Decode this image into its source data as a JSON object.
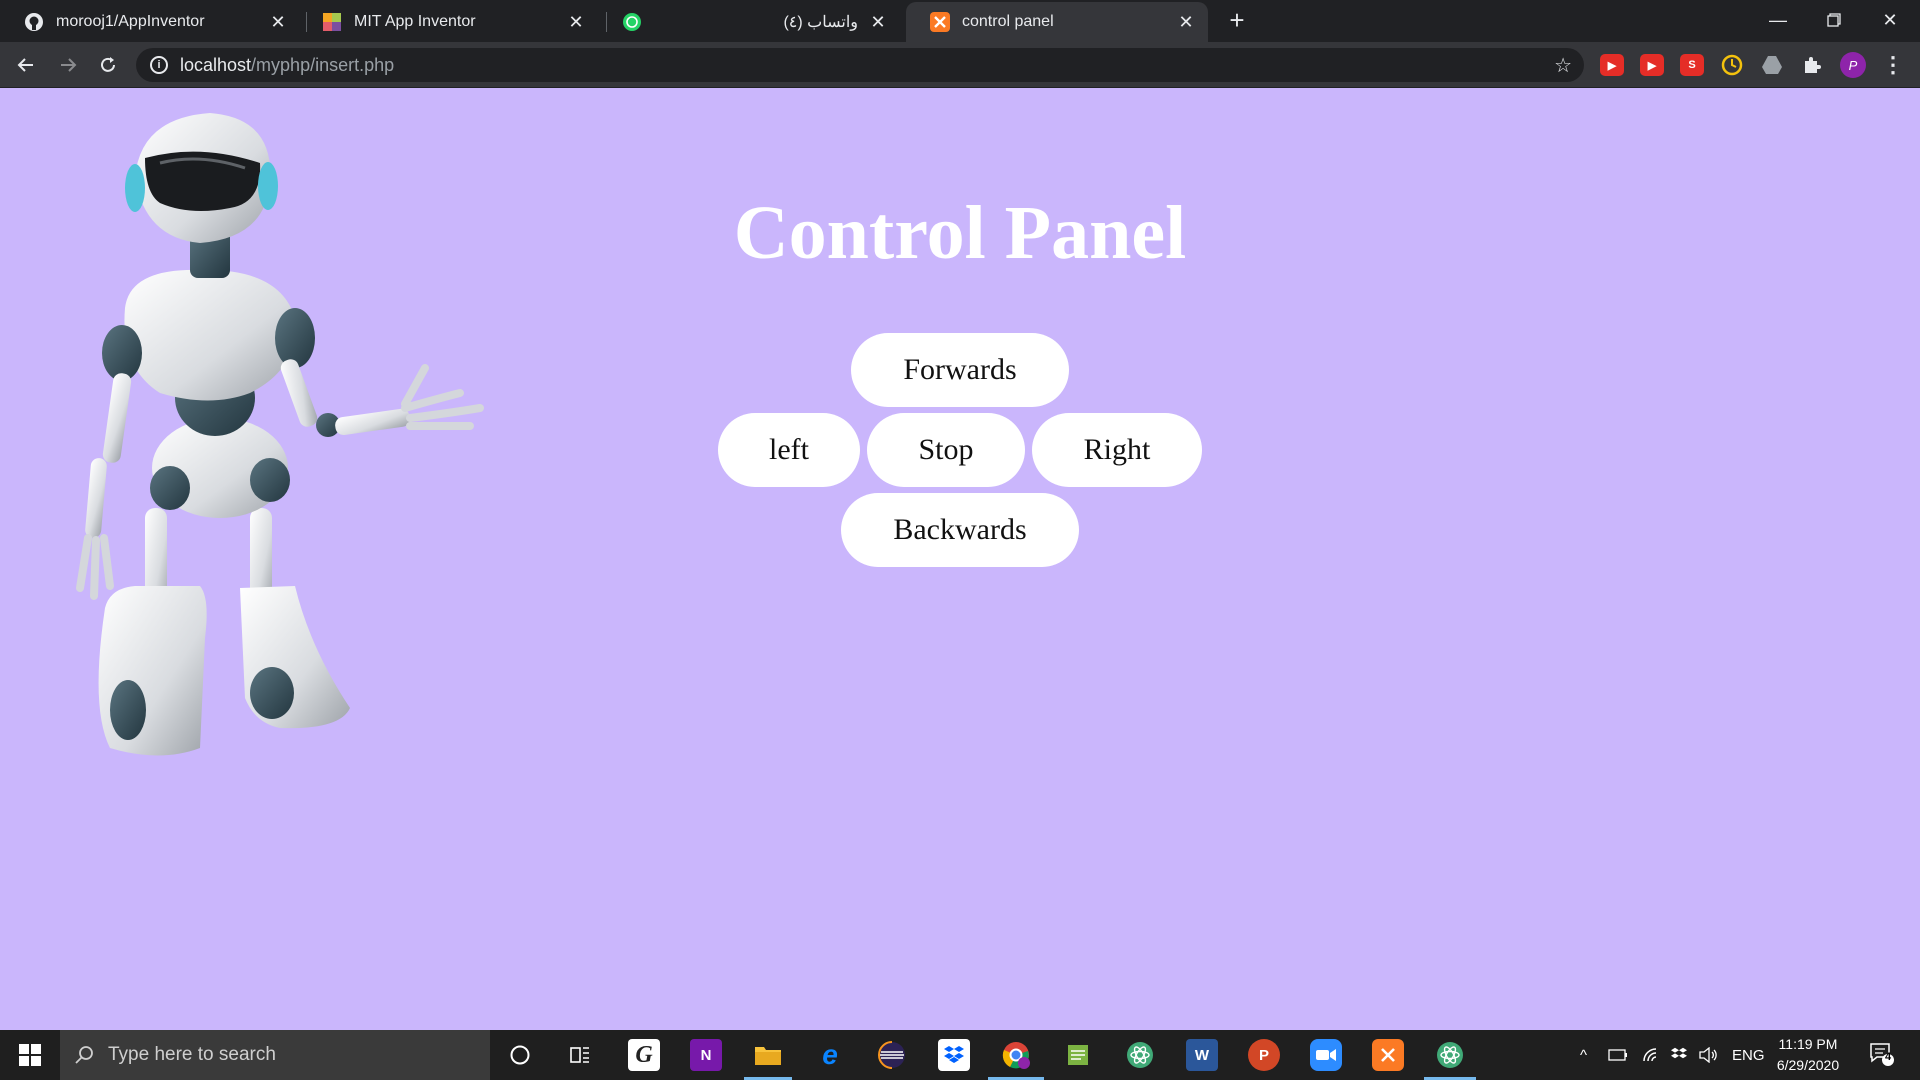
{
  "browser": {
    "tabs": [
      {
        "title": "morooj1/AppInventor",
        "favicon": "github-icon",
        "active": false
      },
      {
        "title": "MIT App Inventor",
        "favicon": "app-inventor-icon",
        "active": false
      },
      {
        "title": "(٤) واتساب",
        "favicon": "whatsapp-icon",
        "active": false
      },
      {
        "title": "control panel",
        "favicon": "xampp-icon",
        "active": true
      }
    ],
    "address": {
      "host": "localhost",
      "path": "/myphp/insert.php"
    },
    "profile_initial": "P",
    "colors": {
      "frame": "#202124",
      "toolbar": "#35363a"
    }
  },
  "page": {
    "title": "Control Panel",
    "background": "#cab6fc",
    "buttons": {
      "forwards": "Forwards",
      "left": "left",
      "stop": "Stop",
      "right": "Right",
      "backwards": "Backwards"
    },
    "illustration": "robot-illustration"
  },
  "taskbar": {
    "search_placeholder": "Type here to search",
    "apps": [
      "cortana-icon",
      "task-view-icon",
      "grammarly-icon",
      "onenote-icon",
      "file-explorer-icon",
      "edge-icon",
      "eclipse-icon",
      "dropbox-icon",
      "chrome-icon",
      "notepad-icon",
      "atom-icon",
      "word-icon",
      "powerpoint-icon",
      "zoom-icon",
      "xampp-icon",
      "atom-icon"
    ],
    "tray": {
      "language": "ENG",
      "time": "11:19 PM",
      "date": "6/29/2020",
      "notifications": "4"
    }
  }
}
